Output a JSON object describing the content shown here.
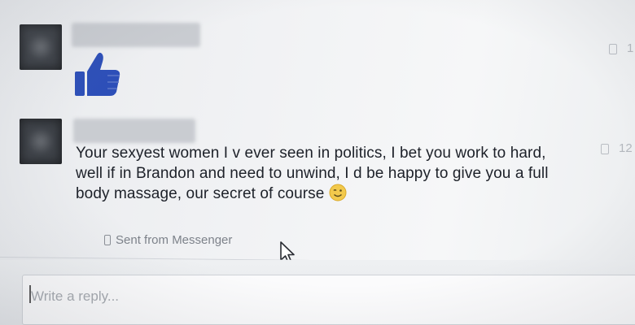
{
  "thread": {
    "messages": [
      {
        "sender_hidden": true,
        "content_type": "like-icon",
        "meta": "1"
      },
      {
        "sender_hidden": true,
        "lines": [
          "Your sexyest women I v ever seen in politics,  I bet you work to hard,",
          "well if in Brandon and need to unwind,  I d be happy to give you a full",
          "body massage,  our secret of course"
        ],
        "emoji": "winking-smiley-icon",
        "sent_from": "Sent from Messenger",
        "meta": "12"
      }
    ]
  },
  "composer": {
    "placeholder": "Write a reply..."
  },
  "colors": {
    "like_blue": "#2d4fb8",
    "emoji_yellow": "#f2c94c",
    "text": "#1d2129",
    "muted": "#7d828a"
  }
}
